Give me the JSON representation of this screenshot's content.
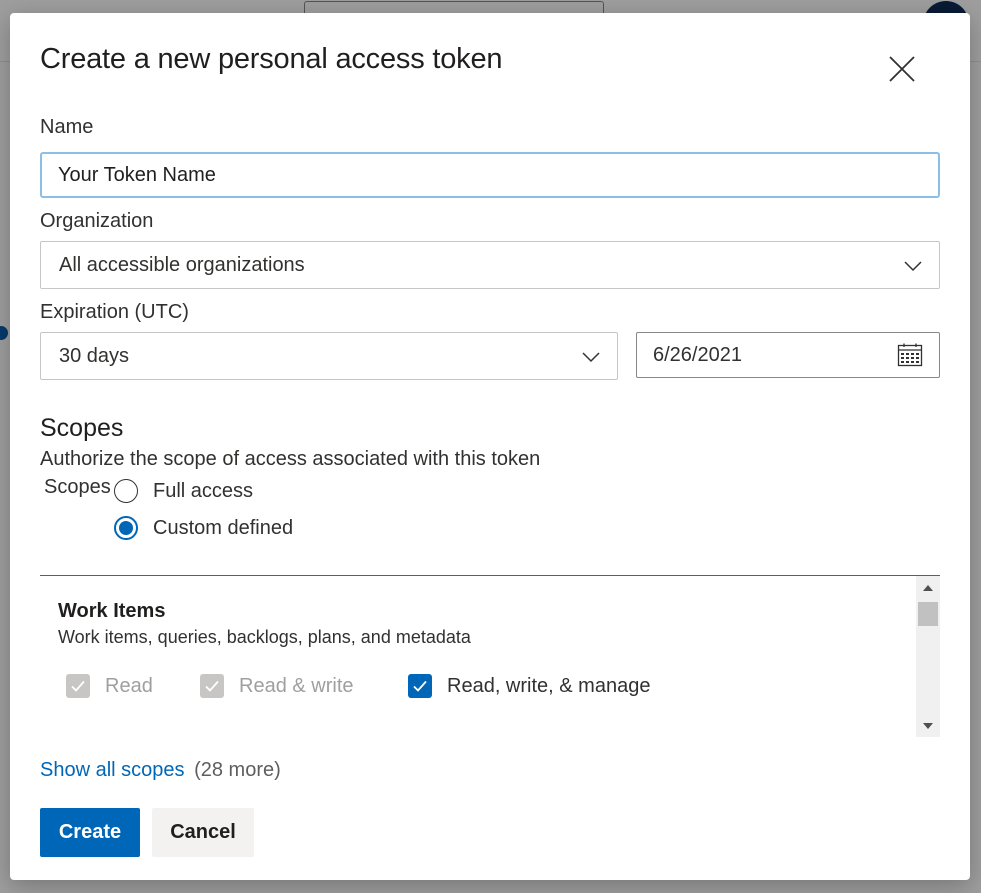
{
  "dialog": {
    "title": "Create a new personal access token"
  },
  "form": {
    "name_label": "Name",
    "name_value": "Your Token Name",
    "organization_label": "Organization",
    "organization_value": "All accessible organizations",
    "expiration_label": "Expiration (UTC)",
    "expiration_value": "30 days",
    "expiration_date": "6/26/2021"
  },
  "scopes": {
    "title": "Scopes",
    "description": "Authorize the scope of access associated with this token",
    "group_label": "Scopes",
    "options": [
      {
        "label": "Full access",
        "selected": false
      },
      {
        "label": "Custom defined",
        "selected": true
      }
    ],
    "list": [
      {
        "name": "Work Items",
        "description": "Work items, queries, backlogs, plans, and metadata",
        "permissions": [
          {
            "label": "Read",
            "checked": true,
            "disabled": true
          },
          {
            "label": "Read & write",
            "checked": true,
            "disabled": true
          },
          {
            "label": "Read, write, & manage",
            "checked": true,
            "disabled": false
          }
        ]
      }
    ],
    "show_all_label": "Show all scopes",
    "more_count": "(28 more)"
  },
  "actions": {
    "create_label": "Create",
    "cancel_label": "Cancel"
  },
  "colors": {
    "accent": "#0067b8",
    "focus_border": "#8cbfe8",
    "disabled_check": "#c8c6c4"
  },
  "icons": {
    "close": "close-icon",
    "dropdown": "chevron-down-icon",
    "calendar": "calendar-icon",
    "check": "checkmark-icon",
    "scroll_up": "scroll-up-arrow-icon",
    "scroll_down": "scroll-down-arrow-icon"
  }
}
